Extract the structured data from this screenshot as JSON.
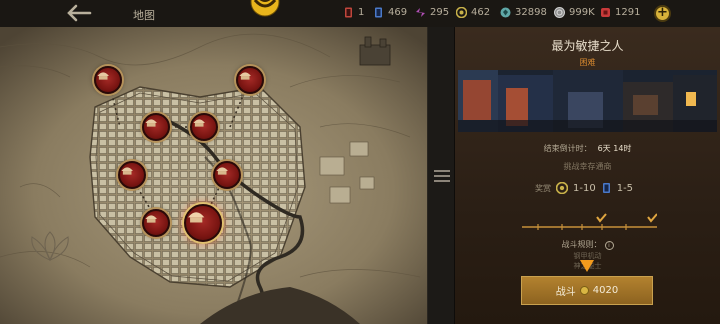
{
  "topbar": {
    "map_label": "地图",
    "resources": [
      {
        "icon": "ticket-icon",
        "value": "1",
        "color": "#c0463c"
      },
      {
        "icon": "card-icon",
        "value": "469",
        "color": "#4a79c9"
      },
      {
        "icon": "shard-icon",
        "value": "295",
        "color": "#b04fb5"
      },
      {
        "icon": "medal-icon",
        "value": "462",
        "color": "#c9b24a"
      },
      {
        "icon": "gem-icon",
        "value": "32898",
        "color": "#5fa8a8"
      },
      {
        "icon": "silver-coin-icon",
        "value": "999K",
        "color": "#b9b9b9"
      },
      {
        "icon": "ruby-icon",
        "value": "1291",
        "color": "#c83a3a"
      }
    ]
  },
  "panel": {
    "title": "最为敏捷之人",
    "difficulty": "困难",
    "timer_label": "结束倒计时：",
    "timer_value": "6天 14时",
    "challenge": "挑战幸存通商",
    "reward_label": "奖赏",
    "reward_a": "1-10",
    "reward_b": "1-5",
    "rules_label": "战斗规则：",
    "rule_1": "钢甲机动",
    "rule_2": "神之能士",
    "fight_label": "战斗",
    "fight_cost": "4020",
    "progress_checks": 2
  },
  "colors": {
    "accent_gold": "#b3822f",
    "difficulty": "#d7892f",
    "node_red": "#8a1b17"
  }
}
